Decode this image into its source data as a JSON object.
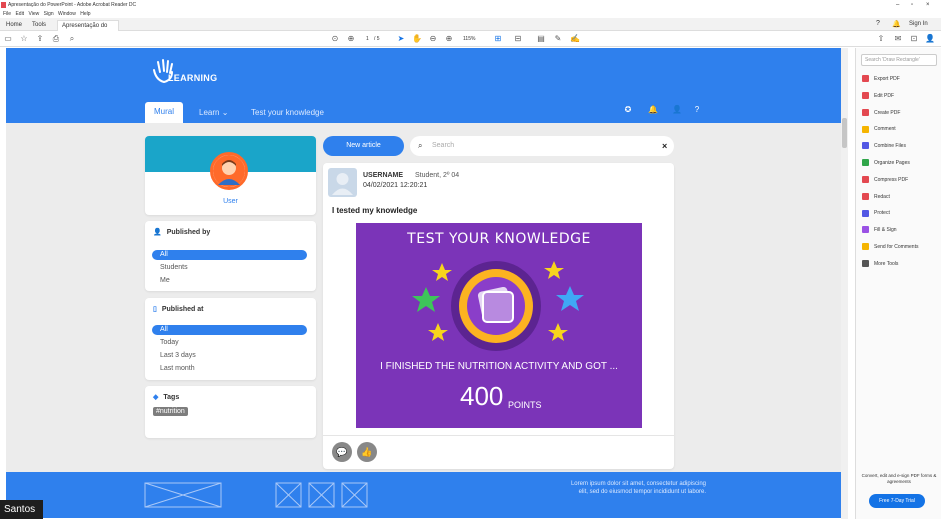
{
  "window": {
    "title": "Apresentação do PowerPoint - Adobe Acrobat Reader DC"
  },
  "menu": [
    "File",
    "Edit",
    "View",
    "Sign",
    "Window",
    "Help"
  ],
  "tabs": {
    "home": "Home",
    "tools": "Tools",
    "doc": "Apresentação do P..."
  },
  "topright": {
    "sign_in": "Sign In"
  },
  "viewer": {
    "page": "1",
    "page_total": "/ 5",
    "zoom": "115%"
  },
  "app": {
    "logo": "LEARNING",
    "nav": {
      "mural": "Mural",
      "learn": "Learn",
      "test": "Test your knowledge"
    }
  },
  "user": {
    "label": "User"
  },
  "published_by": {
    "title": "Published by",
    "options": [
      "All",
      "Students",
      "Me"
    ]
  },
  "published_at": {
    "title": "Published at",
    "options": [
      "All",
      "Today",
      "Last 3 days",
      "Last month"
    ]
  },
  "tags": {
    "title": "Tags",
    "items": [
      "#nutrition"
    ]
  },
  "actions": {
    "new_article": "New article",
    "search_placeholder": "Search"
  },
  "post": {
    "username": "USERNAME",
    "role": "Student, 2º 04",
    "date": "04/02/2021  12:20:21",
    "title": "I tested my knowledge",
    "image": {
      "heading": "TEST YOUR KNOWLEDGE",
      "line": "I FINISHED THE NUTRITION ACTIVITY AND GOT ...",
      "points": "400",
      "points_label": "POINTS"
    }
  },
  "footer": {
    "text": "Lorem ipsum dolor sit amet, consectetur adipiscing elit, sed do eiusmod tempor incididunt ut labore."
  },
  "right_panel": {
    "search_placeholder": "Search 'Draw Rectangle'",
    "tools": [
      {
        "label": "Export PDF",
        "color": "#e34850"
      },
      {
        "label": "Edit PDF",
        "color": "#e34850"
      },
      {
        "label": "Create PDF",
        "color": "#e34850"
      },
      {
        "label": "Comment",
        "color": "#f5b400"
      },
      {
        "label": "Combine Files",
        "color": "#5258e4"
      },
      {
        "label": "Organize Pages",
        "color": "#30a64a"
      },
      {
        "label": "Compress PDF",
        "color": "#e34850"
      },
      {
        "label": "Redact",
        "color": "#e34850"
      },
      {
        "label": "Protect",
        "color": "#5258e4"
      },
      {
        "label": "Fill & Sign",
        "color": "#9a52e4"
      },
      {
        "label": "Send for Comments",
        "color": "#f5b400"
      },
      {
        "label": "More Tools",
        "color": "#555555"
      }
    ],
    "promo": "Convert, edit and e-sign PDF forms & agreements",
    "trial": "Free 7-Day Trial"
  },
  "participant": {
    "name": "Santos"
  }
}
